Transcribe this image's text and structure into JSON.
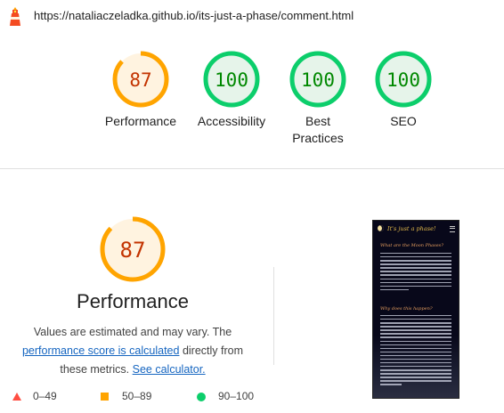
{
  "browser": {
    "url": "https://nataliaczeladka.github.io/its-just-a-phase/comment.html"
  },
  "summary_gauges": [
    {
      "label": "Performance",
      "score": "87",
      "color": "#ffa400",
      "fill": "#fff3e0",
      "text": "#c33300",
      "fraction": 0.87
    },
    {
      "label": "Accessibility",
      "score": "100",
      "color": "#0cce6b",
      "fill": "#e6f4ea",
      "text": "#008800",
      "fraction": 1.0
    },
    {
      "label": "Best Practices",
      "score": "100",
      "color": "#0cce6b",
      "fill": "#e6f4ea",
      "text": "#008800",
      "fraction": 1.0
    },
    {
      "label": "SEO",
      "score": "100",
      "color": "#0cce6b",
      "fill": "#e6f4ea",
      "text": "#008800",
      "fraction": 1.0
    }
  ],
  "performance": {
    "score": "87",
    "fraction": 0.87,
    "title": "Performance",
    "desc_1": "Values are estimated and may vary. The",
    "link_score": "performance score is calculated",
    "desc_2": "directly from these metrics.",
    "link_calc": "See calculator."
  },
  "legend": [
    {
      "icon": "fail-triangle-icon",
      "range": "0–49",
      "color": "#ff4e42"
    },
    {
      "icon": "average-square-icon",
      "range": "50–89",
      "color": "#ffa400"
    },
    {
      "icon": "pass-circle-icon",
      "range": "90–100",
      "color": "#0cce6b"
    }
  ],
  "screenshot": {
    "title": "It's just a phase!",
    "heading_1": "What are the Moon Phases?",
    "heading_2": "Why does this happen?"
  }
}
